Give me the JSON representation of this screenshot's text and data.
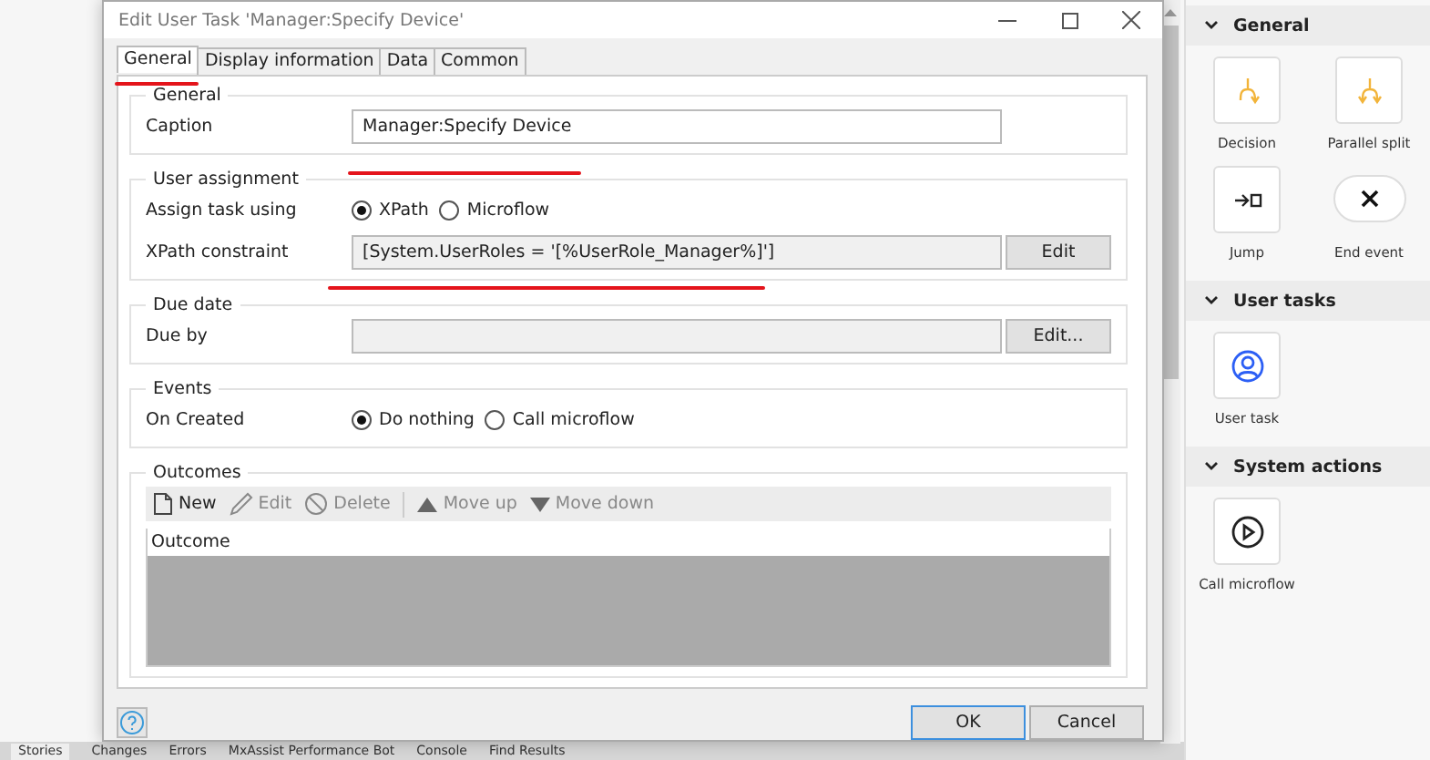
{
  "dialog": {
    "title": "Edit User Task 'Manager:Specify Device'",
    "tabs": [
      {
        "label": "General",
        "selected": true
      },
      {
        "label": "Display information",
        "selected": false
      },
      {
        "label": "Data",
        "selected": false
      },
      {
        "label": "Common",
        "selected": false
      }
    ],
    "general": {
      "legend": "General",
      "caption_label": "Caption",
      "caption_value": "Manager:Specify Device"
    },
    "user_assignment": {
      "legend": "User assignment",
      "assign_label": "Assign task using",
      "options": [
        {
          "label": "XPath",
          "selected": true
        },
        {
          "label": "Microflow",
          "selected": false
        }
      ],
      "xpath_label": "XPath constraint",
      "xpath_value": "[System.UserRoles = '[%UserRole_Manager%]']",
      "button": "Edit"
    },
    "due_date": {
      "legend": "Due date",
      "label": "Due by",
      "button": "Edit..."
    },
    "events": {
      "legend": "Events",
      "label": "On Created",
      "options": [
        {
          "label": "Do nothing",
          "selected": true
        },
        {
          "label": "Call microflow",
          "selected": false
        }
      ]
    },
    "outcomes": {
      "legend": "Outcomes",
      "toolbar": [
        {
          "label": "New",
          "kind": "new",
          "disabled": false
        },
        {
          "label": "Edit",
          "kind": "edit",
          "disabled": true
        },
        {
          "label": "Delete",
          "kind": "delete",
          "disabled": true
        },
        {
          "label": "Move up",
          "kind": "up",
          "disabled": true
        },
        {
          "label": "Move down",
          "kind": "down",
          "disabled": true
        }
      ],
      "columns": [
        "Outcome"
      ]
    },
    "buttons": [
      {
        "label": "OK",
        "default": true
      },
      {
        "label": "Cancel",
        "default": false
      }
    ]
  },
  "toolbox": {
    "sections": [
      {
        "title": "General",
        "expanded": true,
        "items": [
          {
            "label": "Decision",
            "kind": "decision"
          },
          {
            "label": "Parallel split",
            "kind": "parallel_split"
          },
          {
            "label": "Jump",
            "kind": "jump"
          },
          {
            "label": "End event",
            "kind": "end_event"
          }
        ]
      },
      {
        "title": "User tasks",
        "expanded": true,
        "items": [
          {
            "label": "User task",
            "kind": "user_task"
          }
        ]
      },
      {
        "title": "System actions",
        "expanded": true,
        "items": [
          {
            "label": "Call microflow",
            "kind": "call_microflow"
          }
        ]
      }
    ]
  },
  "bottom_tabs": [
    {
      "label": "Stories",
      "selected": true
    },
    {
      "label": "Changes",
      "selected": false
    },
    {
      "label": "Errors",
      "selected": false
    },
    {
      "label": "MxAssist Performance Bot",
      "selected": false
    },
    {
      "label": "Console",
      "selected": false
    },
    {
      "label": "Find Results",
      "selected": false
    }
  ]
}
